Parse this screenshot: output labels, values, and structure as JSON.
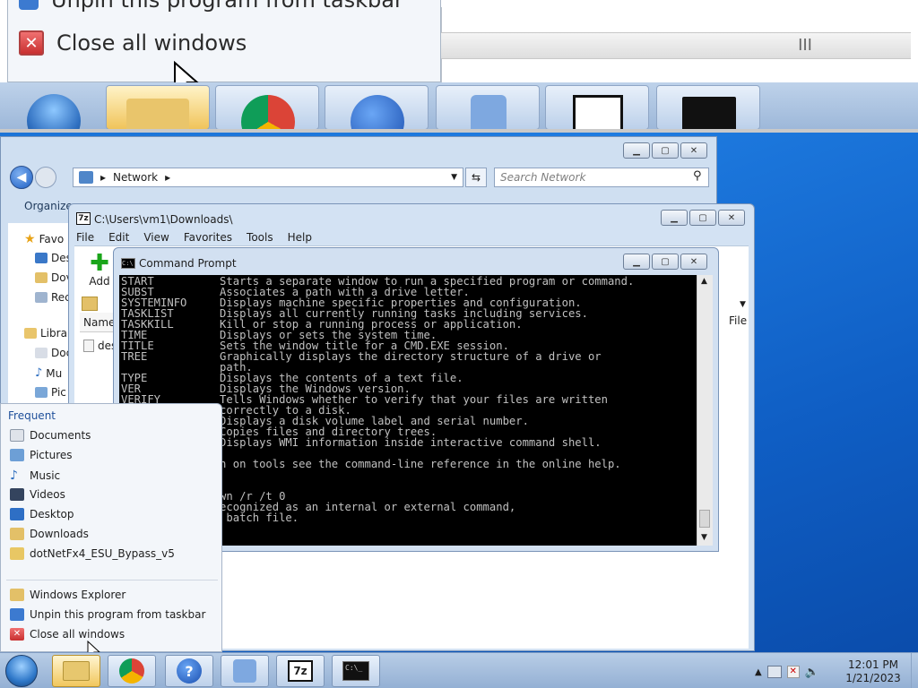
{
  "zoom": {
    "menu_item_unpin_partial": "Unpin this program from taskbar",
    "menu_item_close": "Close all windows",
    "scroll_grip": "III"
  },
  "network_window": {
    "address_segment": "Network",
    "search_placeholder": "Search Network",
    "organize_label": "Organize",
    "nav": {
      "favorites": "Favo",
      "desktop": "Des",
      "downloads": "Dov",
      "recent": "Rec",
      "libraries": "Libra",
      "documents": "Doc",
      "music": "Mu",
      "pictures": "Pic"
    }
  },
  "zip_window": {
    "title": "C:\\Users\\vm1\\Downloads\\",
    "menu": [
      "File",
      "Edit",
      "View",
      "Favorites",
      "Tools",
      "Help"
    ],
    "add_label": "Add",
    "col_name": "Name",
    "col_file": "File",
    "file_row": "des"
  },
  "cmd_window": {
    "title": "Command Prompt",
    "lines": [
      "START          Starts a separate window to run a specified program or command.",
      "SUBST          Associates a path with a drive letter.",
      "SYSTEMINFO     Displays machine specific properties and configuration.",
      "TASKLIST       Displays all currently running tasks including services.",
      "TASKKILL       Kill or stop a running process or application.",
      "TIME           Displays or sets the system time.",
      "TITLE          Sets the window title for a CMD.EXE session.",
      "TREE           Graphically displays the directory structure of a drive or",
      "               path.",
      "TYPE           Displays the contents of a text file.",
      "VER            Displays the Windows version.",
      "VERIFY         Tells Windows whether to verify that your files are written",
      "               correctly to a disk.",
      "               Displays a disk volume label and serial number.",
      "               Copies files and directory trees.",
      "               Displays WMI information inside interactive command shell.",
      "",
      "          mation on tools see the command-line reference in the online help.",
      "",
      "",
      "          hutdown /r /t 0",
      "          not recognized as an internal or external command,",
      "          am or batch file."
    ]
  },
  "jumplist": {
    "frequent_header": "Frequent",
    "frequent": [
      "Documents",
      "Pictures",
      "Music",
      "Videos",
      "Desktop",
      "Downloads",
      "dotNetFx4_ESU_Bypass_v5"
    ],
    "tasks": [
      "Windows Explorer",
      "Unpin this program from taskbar",
      "Close all windows"
    ]
  },
  "taskbar": {
    "clock_time": "12:01 PM",
    "clock_date": "1/21/2023"
  },
  "icons": [
    "windows-start-icon",
    "folder-icon",
    "chrome-icon",
    "help-icon",
    "network-icon",
    "7zip-icon",
    "cmd-icon"
  ]
}
